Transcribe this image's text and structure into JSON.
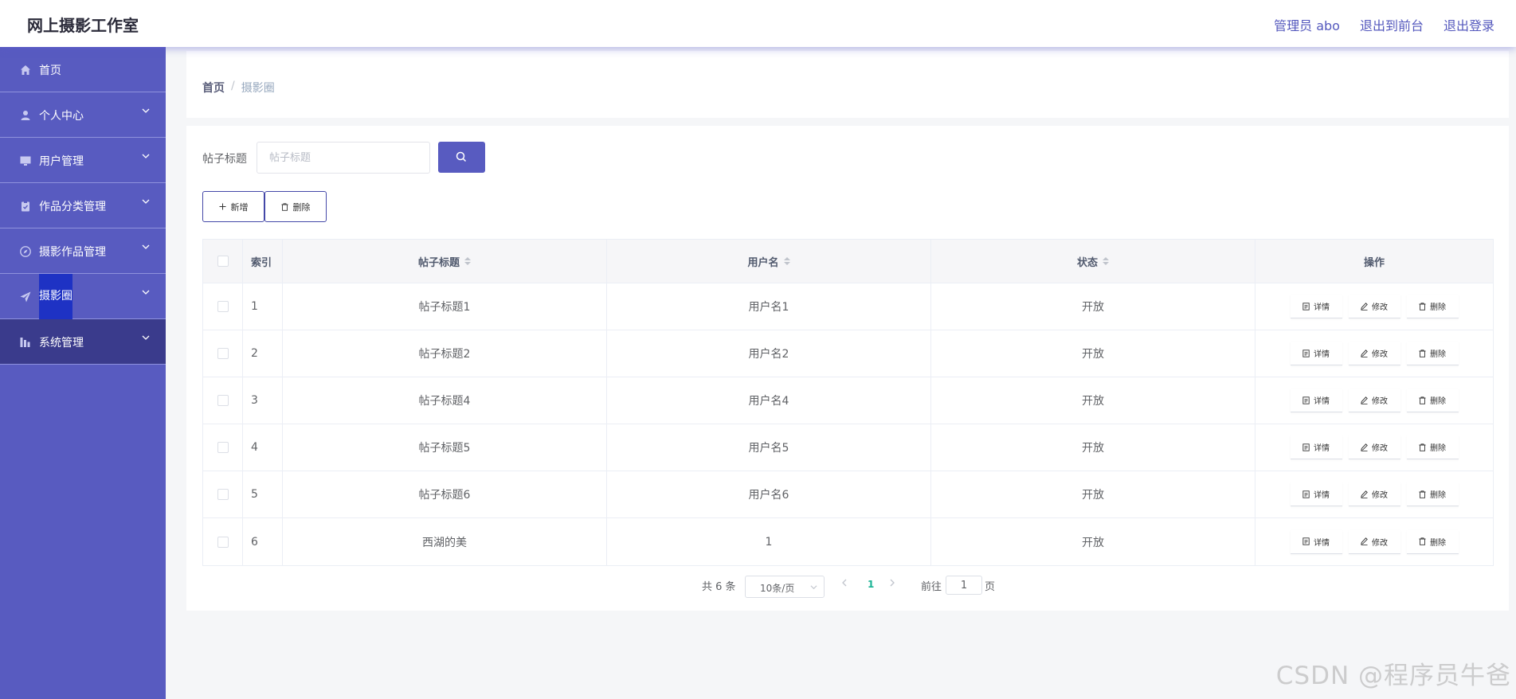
{
  "header": {
    "title": "网上摄影工作室",
    "links": [
      "管理员 abo",
      "退出到前台",
      "退出登录"
    ]
  },
  "sidebar": {
    "items": [
      {
        "label": "首页",
        "icon": "home-icon",
        "has_children": false
      },
      {
        "label": "个人中心",
        "icon": "user-icon",
        "has_children": true
      },
      {
        "label": "用户管理",
        "icon": "monitor-icon",
        "has_children": true
      },
      {
        "label": "作品分类管理",
        "icon": "clipboard-icon",
        "has_children": true
      },
      {
        "label": "摄影作品管理",
        "icon": "compass-icon",
        "has_children": true
      },
      {
        "label": "摄影圈",
        "icon": "send-icon",
        "has_children": true
      },
      {
        "label": "系统管理",
        "icon": "chart-icon",
        "has_children": true
      }
    ]
  },
  "breadcrumb": {
    "home": "首页",
    "separator": "/",
    "current": "摄影圈"
  },
  "search": {
    "label": "帖子标题",
    "placeholder": "帖子标题"
  },
  "toolbar": {
    "add_label": "新增",
    "delete_label": "删除"
  },
  "table": {
    "headers": {
      "index": "索引",
      "title": "帖子标题",
      "username": "用户名",
      "status": "状态",
      "actions": "操作"
    },
    "rows": [
      {
        "index": "1",
        "title": "帖子标题1",
        "username": "用户名1",
        "status": "开放"
      },
      {
        "index": "2",
        "title": "帖子标题2",
        "username": "用户名2",
        "status": "开放"
      },
      {
        "index": "3",
        "title": "帖子标题4",
        "username": "用户名4",
        "status": "开放"
      },
      {
        "index": "4",
        "title": "帖子标题5",
        "username": "用户名5",
        "status": "开放"
      },
      {
        "index": "5",
        "title": "帖子标题6",
        "username": "用户名6",
        "status": "开放"
      },
      {
        "index": "6",
        "title": "西湖的美",
        "username": "1",
        "status": "开放"
      }
    ],
    "row_actions": {
      "detail": "详情",
      "edit": "修改",
      "delete": "删除"
    }
  },
  "pagination": {
    "total": "共 6 条",
    "page_size": "10条/页",
    "current_page": "1",
    "goto_label": "前往",
    "goto_value": "1",
    "page_suffix": "页"
  },
  "watermark": "CSDN @程序员牛爸",
  "colors": {
    "accent": "#585bc0",
    "sidebar_active": "#3a3b8c",
    "page_active": "#19b394"
  }
}
